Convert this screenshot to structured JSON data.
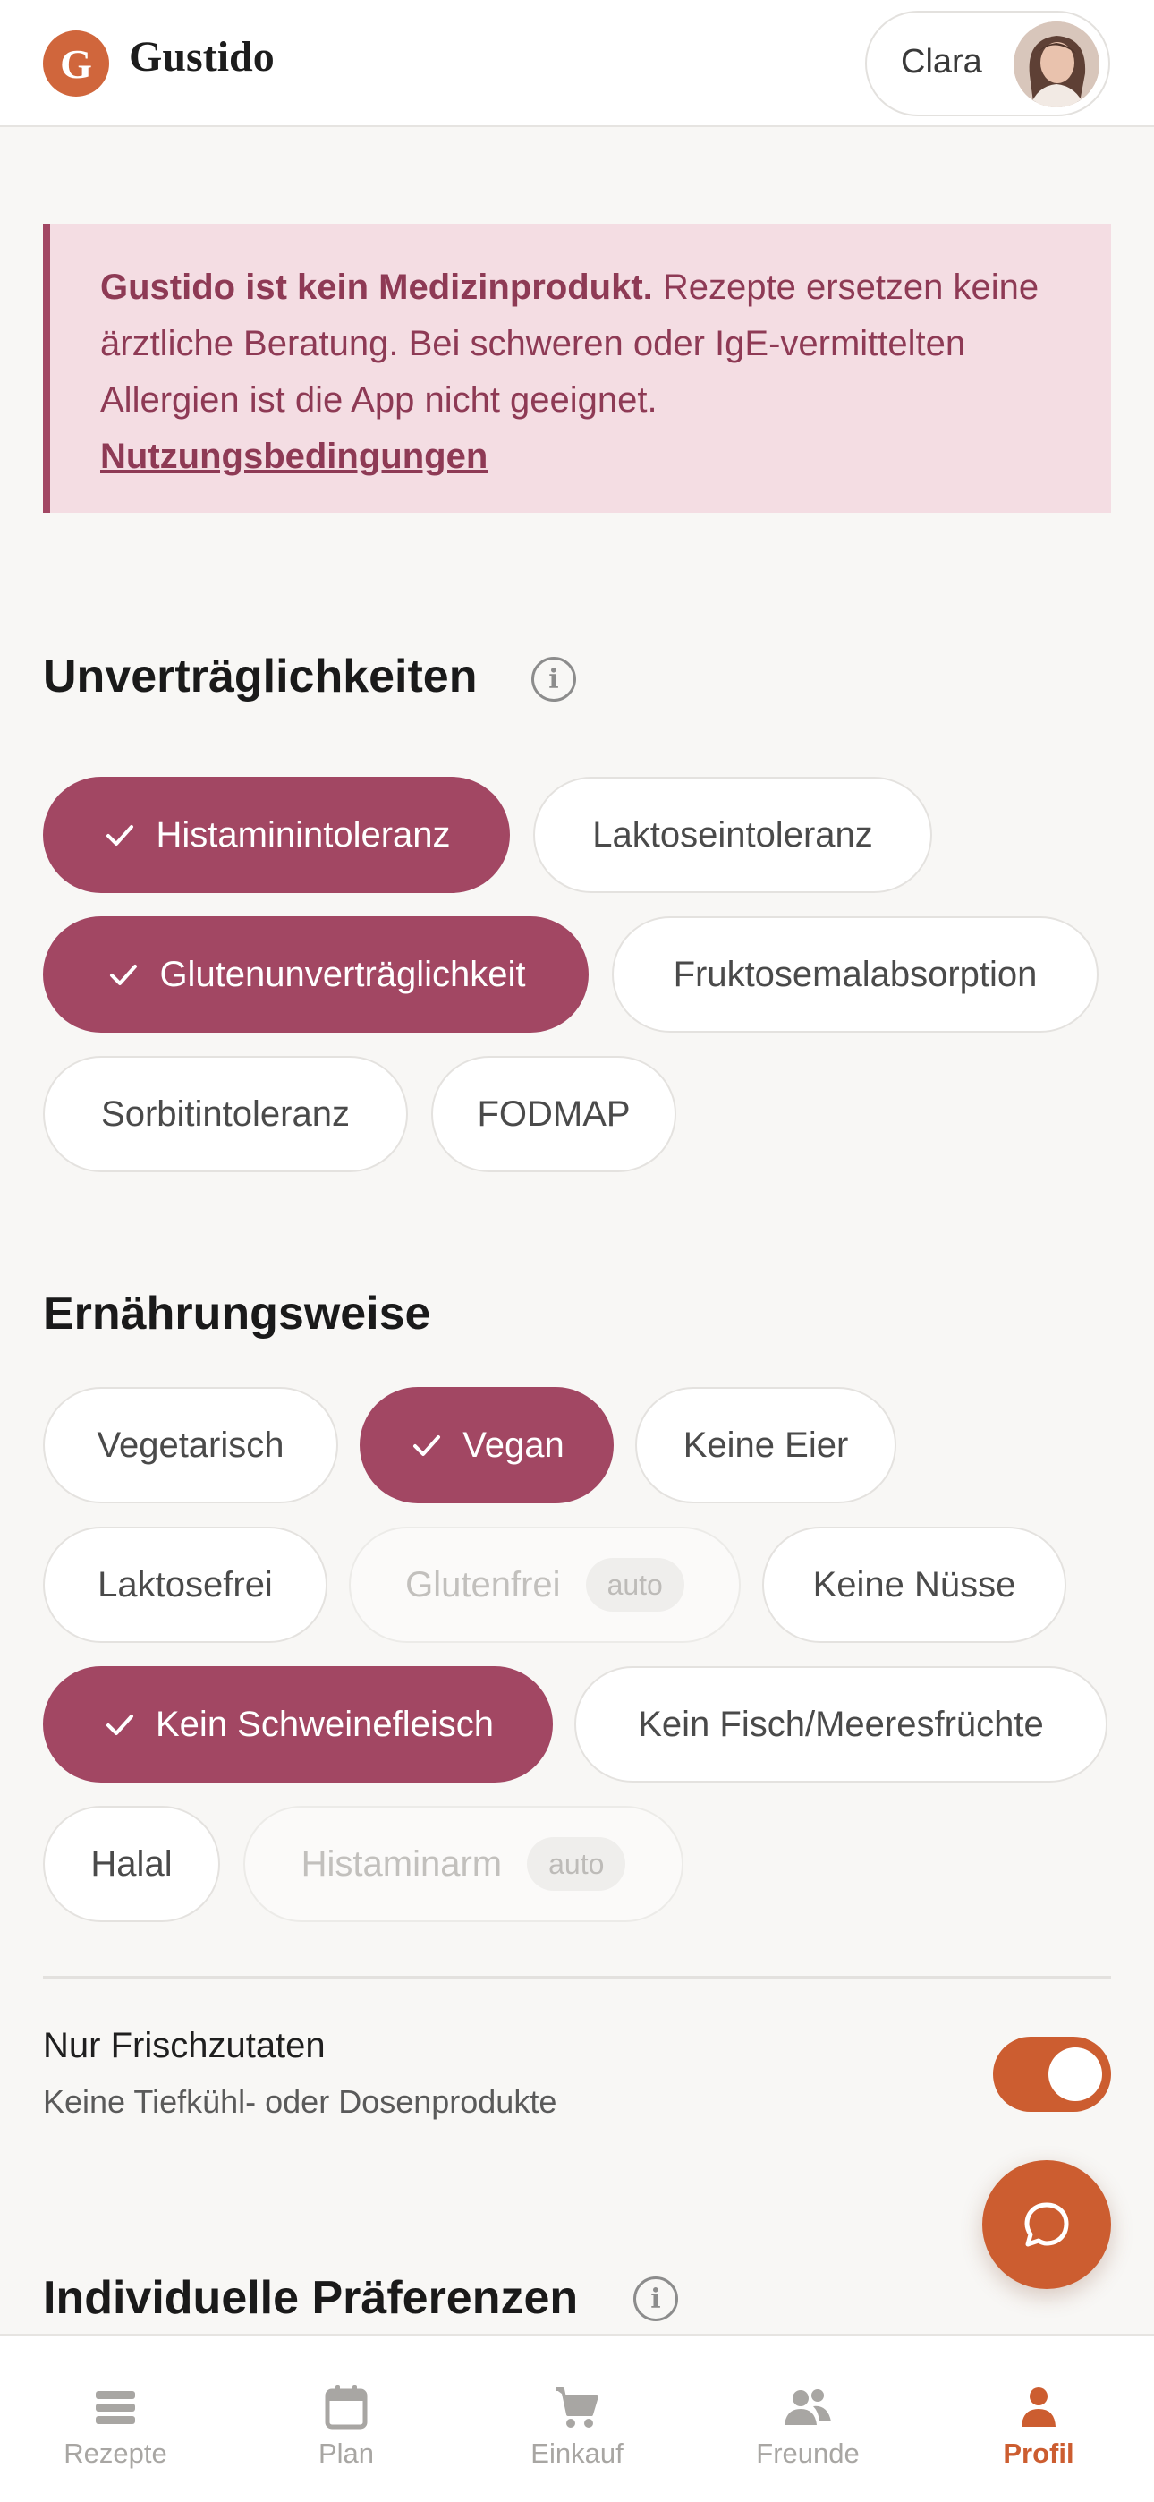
{
  "header": {
    "brand": "Gustido",
    "logo_letter": "G",
    "user_name": "Clara"
  },
  "disclaimer": {
    "bold": "Gustido ist kein Medizinprodukt.",
    "text": " Rezepte ersetzen keine ärztliche Beratung. Bei schweren oder IgE-vermittelten Allergien ist die App nicht geeignet.",
    "link": "Nutzungsbedingungen"
  },
  "intolerances": {
    "title": "Unverträglichkeiten",
    "chips": [
      {
        "label": "Histaminintoleranz",
        "selected": true
      },
      {
        "label": "Laktoseintoleranz",
        "selected": false
      },
      {
        "label": "Glutenunverträglichkeit",
        "selected": true
      },
      {
        "label": "Fruktosemalabsorption",
        "selected": false
      },
      {
        "label": "Sorbitintoleranz",
        "selected": false
      },
      {
        "label": "FODMAP",
        "selected": false
      }
    ]
  },
  "diet": {
    "title": "Ernährungsweise",
    "auto_label": "auto",
    "chips": [
      {
        "label": "Vegetarisch",
        "selected": false
      },
      {
        "label": "Vegan",
        "selected": true
      },
      {
        "label": "Keine Eier",
        "selected": false
      },
      {
        "label": "Laktosefrei",
        "selected": false
      },
      {
        "label": "Glutenfrei",
        "selected": false,
        "disabled": true
      },
      {
        "label": "Keine Nüsse",
        "selected": false
      },
      {
        "label": "Kein Schweinefleisch",
        "selected": true
      },
      {
        "label": "Kein Fisch/Meeresfrüchte",
        "selected": false
      },
      {
        "label": "Halal",
        "selected": false
      },
      {
        "label": "Histaminarm",
        "selected": false,
        "disabled": true
      }
    ]
  },
  "fresh": {
    "title": "Nur Frischzutaten",
    "subtitle": "Keine Tiefkühl- oder Dosenprodukte",
    "enabled": true
  },
  "preferences": {
    "title": "Individuelle Präferenzen"
  },
  "nav": {
    "items": [
      {
        "label": "Rezepte",
        "icon": "recipes-icon",
        "active": false
      },
      {
        "label": "Plan",
        "icon": "calendar-icon",
        "active": false
      },
      {
        "label": "Einkauf",
        "icon": "cart-icon",
        "active": false
      },
      {
        "label": "Freunde",
        "icon": "friends-icon",
        "active": false
      },
      {
        "label": "Profil",
        "icon": "profile-icon",
        "active": true
      }
    ]
  },
  "colors": {
    "accent": "#cc5d30",
    "selected_chip": "#a24763",
    "disclaimer_bg": "#f4dde3"
  }
}
